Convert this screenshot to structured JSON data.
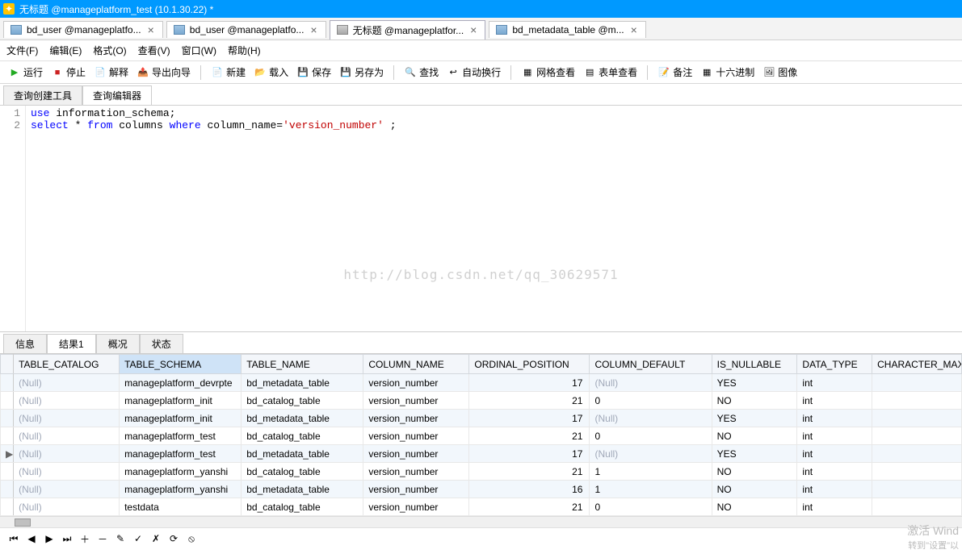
{
  "title": "无标题 @manageplatform_test (10.1.30.22) *",
  "doc_tabs": [
    {
      "label": "bd_user @manageplatfo...",
      "active": false,
      "icon": "table"
    },
    {
      "label": "bd_user @manageplatfo...",
      "active": false,
      "icon": "table"
    },
    {
      "label": "无标题 @manageplatfor...",
      "active": true,
      "icon": "sql"
    },
    {
      "label": "bd_metadata_table @m...",
      "active": false,
      "icon": "table"
    }
  ],
  "menu": {
    "file": "文件(F)",
    "edit": "编辑(E)",
    "format": "格式(O)",
    "view": "查看(V)",
    "window": "窗口(W)",
    "help": "帮助(H)"
  },
  "toolbar": {
    "run": "运行",
    "stop": "停止",
    "parse": "解释",
    "export": "导出向导",
    "new": "新建",
    "load": "载入",
    "save": "保存",
    "saveas": "另存为",
    "find": "查找",
    "wrap": "自动换行",
    "gridview": "网格查看",
    "formview": "表单查看",
    "note": "备注",
    "hex": "十六进制",
    "image": "图像"
  },
  "subtabs": {
    "builder": "查询创建工具",
    "editor": "查询编辑器"
  },
  "sql": {
    "line1": {
      "num": "1",
      "kw1": "use",
      "rest": " information_schema;"
    },
    "line2": {
      "num": "2",
      "kw1": "select",
      "t1": " * ",
      "kw2": "from",
      "t2": " columns ",
      "kw3": "where",
      "t3": " column_name=",
      "str": "'version_number'",
      "t4": " ;"
    }
  },
  "watermark": "http://blog.csdn.net/qq_30629571",
  "bottom_tabs": {
    "info": "信息",
    "result": "结果1",
    "overview": "概况",
    "status": "状态"
  },
  "columns": [
    "TABLE_CATALOG",
    "TABLE_SCHEMA",
    "TABLE_NAME",
    "COLUMN_NAME",
    "ORDINAL_POSITION",
    "COLUMN_DEFAULT",
    "IS_NULLABLE",
    "DATA_TYPE",
    "CHARACTER_MAX"
  ],
  "rows": [
    {
      "cat": "(Null)",
      "sch": "manageplatform_devrpte",
      "tbl": "bd_metadata_table",
      "col": "version_number",
      "ord": "17",
      "def": "(Null)",
      "nul": "YES",
      "typ": "int",
      "cur": false,
      "alt": true
    },
    {
      "cat": "(Null)",
      "sch": "manageplatform_init",
      "tbl": "bd_catalog_table",
      "col": "version_number",
      "ord": "21",
      "def": "0",
      "nul": "NO",
      "typ": "int",
      "cur": false,
      "alt": false
    },
    {
      "cat": "(Null)",
      "sch": "manageplatform_init",
      "tbl": "bd_metadata_table",
      "col": "version_number",
      "ord": "17",
      "def": "(Null)",
      "nul": "YES",
      "typ": "int",
      "cur": false,
      "alt": true
    },
    {
      "cat": "(Null)",
      "sch": "manageplatform_test",
      "tbl": "bd_catalog_table",
      "col": "version_number",
      "ord": "21",
      "def": "0",
      "nul": "NO",
      "typ": "int",
      "cur": false,
      "alt": false
    },
    {
      "cat": "(Null)",
      "sch": "manageplatform_test",
      "tbl": "bd_metadata_table",
      "col": "version_number",
      "ord": "17",
      "def": "(Null)",
      "nul": "YES",
      "typ": "int",
      "cur": true,
      "alt": true
    },
    {
      "cat": "(Null)",
      "sch": "manageplatform_yanshi",
      "tbl": "bd_catalog_table",
      "col": "version_number",
      "ord": "21",
      "def": "1",
      "nul": "NO",
      "typ": "int",
      "cur": false,
      "alt": false
    },
    {
      "cat": "(Null)",
      "sch": "manageplatform_yanshi",
      "tbl": "bd_metadata_table",
      "col": "version_number",
      "ord": "16",
      "def": "1",
      "nul": "NO",
      "typ": "int",
      "cur": false,
      "alt": true
    },
    {
      "cat": "(Null)",
      "sch": "testdata",
      "tbl": "bd_catalog_table",
      "col": "version_number",
      "ord": "21",
      "def": "0",
      "nul": "NO",
      "typ": "int",
      "cur": false,
      "alt": false
    }
  ],
  "corner": {
    "l1": "激活 Wind",
    "l2": "转到\"设置\"以"
  }
}
